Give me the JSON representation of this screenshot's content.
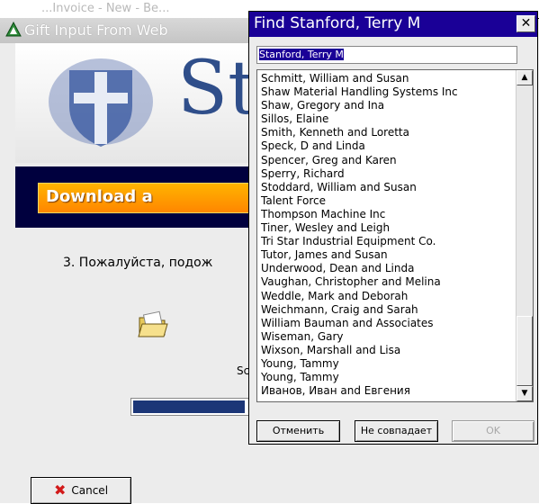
{
  "background_window": {
    "top_strip_text": "...Invoice - New - Be...",
    "title": "Gift Input From Web",
    "banner_text": "St",
    "download_text": "Download a",
    "step_text": "3.  Пожалуйста, подож",
    "partial_label": "Sc",
    "progress": 0.85,
    "cancel_label": "Cancel"
  },
  "dialog": {
    "title": "Find Stanford, Terry M",
    "search_value": "Stanford, Terry M",
    "items": [
      "Schmitt, William and Susan",
      "Shaw Material Handling Systems Inc",
      "Shaw, Gregory and Ina",
      "Sillos, Elaine",
      "Smith, Kenneth and Loretta",
      "Speck, D and Linda",
      "Spencer, Greg and Karen",
      "Sperry, Richard",
      "Stoddard, William and Susan",
      "Talent Force",
      "Thompson Machine Inc",
      "Tiner, Wesley and Leigh",
      "Tri Star Industrial Equipment Co.",
      "Tutor, James and Susan",
      "Underwood, Dean and Linda",
      "Vaughan, Christopher and Melina",
      "Weddle, Mark and Deborah",
      "Weichmann, Craig and Sarah",
      "William Bauman and Associates",
      "Wiseman, Gary",
      "Wixson, Marshall and Lisa",
      "Young, Tammy",
      "Young, Tammy",
      "Иванов, Иван and Евгения"
    ],
    "buttons": {
      "cancel": "Отменить",
      "no_match": "Не совпадает",
      "ok": "OK"
    }
  },
  "colors": {
    "dialog_title_bg": "#1a0097",
    "download_bar_bg": "#00003e",
    "download_button": "#ff9a00",
    "banner_text": "#2f4e8a",
    "cancel_x": "#d21a1a"
  }
}
